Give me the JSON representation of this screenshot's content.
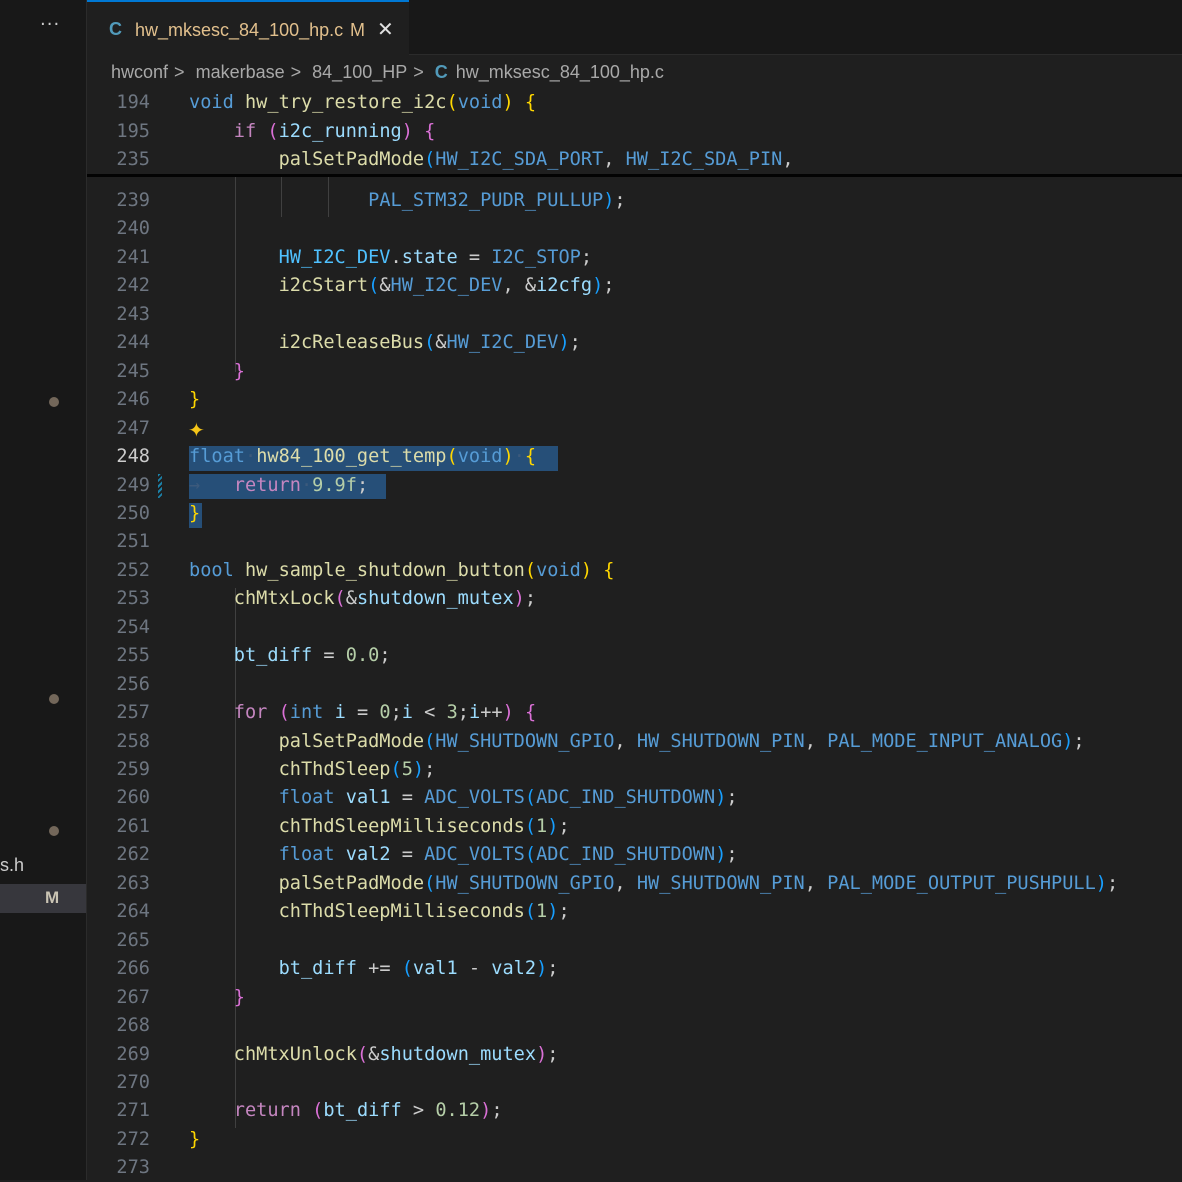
{
  "sidebar": {
    "more_label": "···",
    "file_fragment": "s.h",
    "file_status": "M"
  },
  "tab": {
    "icon": "C",
    "label": "hw_mksesc_84_100_hp.c",
    "modified": "M",
    "close": "✕"
  },
  "breadcrumb": {
    "items": [
      "hwconf",
      "makerbase",
      "84_100_HP"
    ],
    "file_icon": "C",
    "file": "hw_mksesc_84_100_hp.c",
    "separator": ">"
  },
  "sticky_lines": [
    {
      "ln": "194",
      "segments": [
        [
          "kw",
          "void"
        ],
        [
          "",
          " "
        ],
        [
          "fn",
          "hw_try_restore_i2c"
        ],
        [
          "p1",
          "("
        ],
        [
          "kw",
          "void"
        ],
        [
          "p1",
          ")"
        ],
        [
          "",
          ""
        ],
        [
          "",
          " "
        ],
        [
          "p1",
          "{"
        ]
      ]
    },
    {
      "ln": "195",
      "segments": [
        [
          "",
          "    "
        ],
        [
          "ctl",
          "if"
        ],
        [
          "",
          " "
        ],
        [
          "p2",
          "("
        ],
        [
          "var",
          "i2c_running"
        ],
        [
          "p2",
          ")"
        ],
        [
          "",
          " "
        ],
        [
          "p2",
          "{"
        ]
      ]
    },
    {
      "ln": "235",
      "segments": [
        [
          "",
          "        "
        ],
        [
          "fn",
          "palSetPadMode"
        ],
        [
          "p3",
          "("
        ],
        [
          "mac",
          "HW_I2C_SDA_PORT"
        ],
        [
          "",
          ", "
        ],
        [
          "mac",
          "HW_I2C_SDA_PIN"
        ],
        [
          "",
          ","
        ]
      ]
    }
  ],
  "code_lines": [
    {
      "ln": "239",
      "segments": [
        [
          "",
          "                "
        ],
        [
          "mac",
          "PAL_STM32_PUDR_PULLUP"
        ],
        [
          "p3",
          ")"
        ],
        [
          "",
          ";"
        ]
      ]
    },
    {
      "ln": "240",
      "segments": []
    },
    {
      "ln": "241",
      "segments": [
        [
          "",
          "        "
        ],
        [
          "cst",
          "HW_I2C_DEV"
        ],
        [
          "",
          ""
        ],
        [
          "",
          "."
        ],
        [
          "var",
          "state"
        ],
        [
          "",
          " = "
        ],
        [
          "mac",
          "I2C_STOP"
        ],
        [
          "",
          ";"
        ]
      ]
    },
    {
      "ln": "242",
      "segments": [
        [
          "",
          "        "
        ],
        [
          "fn",
          "i2cStart"
        ],
        [
          "p3",
          "("
        ],
        [
          "",
          "&"
        ],
        [
          "mac",
          "HW_I2C_DEV"
        ],
        [
          "",
          ", &"
        ],
        [
          "var",
          "i2cfg"
        ],
        [
          "p3",
          ")"
        ],
        [
          "",
          ";"
        ]
      ]
    },
    {
      "ln": "243",
      "segments": []
    },
    {
      "ln": "244",
      "segments": [
        [
          "",
          "        "
        ],
        [
          "fn",
          "i2cReleaseBus"
        ],
        [
          "p3",
          "("
        ],
        [
          "",
          "&"
        ],
        [
          "mac",
          "HW_I2C_DEV"
        ],
        [
          "p3",
          ")"
        ],
        [
          "",
          ";"
        ]
      ]
    },
    {
      "ln": "245",
      "segments": [
        [
          "",
          "    "
        ],
        [
          "p2",
          "}"
        ]
      ]
    },
    {
      "ln": "246",
      "segments": [
        [
          "p1",
          "}"
        ]
      ]
    },
    {
      "ln": "247",
      "segments": []
    },
    {
      "ln": "248",
      "segments": [
        [
          "kw",
          "float"
        ],
        [
          "ws",
          "·"
        ],
        [
          "fn",
          "hw84_100_get_temp"
        ],
        [
          "p1",
          "("
        ],
        [
          "kw",
          "void"
        ],
        [
          "p1",
          ")"
        ],
        [
          "ws",
          "·"
        ],
        [
          "p1",
          "{"
        ]
      ]
    },
    {
      "ln": "249",
      "segments": [
        [
          "ws",
          "→   "
        ],
        [
          "ctl",
          "return"
        ],
        [
          "ws",
          "·"
        ],
        [
          "num",
          "9.9f"
        ],
        [
          "",
          ";"
        ]
      ]
    },
    {
      "ln": "250",
      "segments": [
        [
          "p1",
          "}"
        ]
      ]
    },
    {
      "ln": "251",
      "segments": []
    },
    {
      "ln": "252",
      "segments": [
        [
          "kw",
          "bool"
        ],
        [
          "",
          " "
        ],
        [
          "fn",
          "hw_sample_shutdown_button"
        ],
        [
          "p1",
          "("
        ],
        [
          "kw",
          "void"
        ],
        [
          "p1",
          ")"
        ],
        [
          "",
          " "
        ],
        [
          "p1",
          "{"
        ]
      ]
    },
    {
      "ln": "253",
      "segments": [
        [
          "",
          "    "
        ],
        [
          "fn",
          "chMtxLock"
        ],
        [
          "p2",
          "("
        ],
        [
          "",
          "&"
        ],
        [
          "var",
          "shutdown_mutex"
        ],
        [
          "p2",
          ")"
        ],
        [
          "",
          ";"
        ]
      ]
    },
    {
      "ln": "254",
      "segments": []
    },
    {
      "ln": "255",
      "segments": [
        [
          "",
          "    "
        ],
        [
          "var",
          "bt_diff"
        ],
        [
          "",
          " = "
        ],
        [
          "num",
          "0.0"
        ],
        [
          "",
          ";"
        ]
      ]
    },
    {
      "ln": "256",
      "segments": []
    },
    {
      "ln": "257",
      "segments": [
        [
          "",
          "    "
        ],
        [
          "ctl",
          "for"
        ],
        [
          "",
          " "
        ],
        [
          "p2",
          "("
        ],
        [
          "kw",
          "int"
        ],
        [
          "",
          " "
        ],
        [
          "var",
          "i"
        ],
        [
          "",
          " = "
        ],
        [
          "num",
          "0"
        ],
        [
          "",
          ";"
        ],
        [
          "var",
          "i"
        ],
        [
          "",
          " < "
        ],
        [
          "num",
          "3"
        ],
        [
          "",
          ";"
        ],
        [
          "var",
          "i"
        ],
        [
          "",
          "++"
        ],
        [
          "p2",
          ")"
        ],
        [
          "",
          " "
        ],
        [
          "p2",
          "{"
        ]
      ]
    },
    {
      "ln": "258",
      "segments": [
        [
          "",
          "        "
        ],
        [
          "fn",
          "palSetPadMode"
        ],
        [
          "p3",
          "("
        ],
        [
          "mac",
          "HW_SHUTDOWN_GPIO"
        ],
        [
          "",
          ", "
        ],
        [
          "mac",
          "HW_SHUTDOWN_PIN"
        ],
        [
          "",
          ", "
        ],
        [
          "mac",
          "PAL_MODE_INPUT_ANALOG"
        ],
        [
          "p3",
          ")"
        ],
        [
          "",
          ";"
        ]
      ]
    },
    {
      "ln": "259",
      "segments": [
        [
          "",
          "        "
        ],
        [
          "fn",
          "chThdSleep"
        ],
        [
          "p3",
          "("
        ],
        [
          "num",
          "5"
        ],
        [
          "p3",
          ")"
        ],
        [
          "",
          ";"
        ]
      ]
    },
    {
      "ln": "260",
      "segments": [
        [
          "",
          "        "
        ],
        [
          "kw",
          "float"
        ],
        [
          "",
          " "
        ],
        [
          "var",
          "val1"
        ],
        [
          "",
          " = "
        ],
        [
          "mac",
          "ADC_VOLTS"
        ],
        [
          "p3",
          "("
        ],
        [
          "mac",
          "ADC_IND_SHUTDOWN"
        ],
        [
          "p3",
          ")"
        ],
        [
          "",
          ";"
        ]
      ]
    },
    {
      "ln": "261",
      "segments": [
        [
          "",
          "        "
        ],
        [
          "fn",
          "chThdSleepMilliseconds"
        ],
        [
          "p3",
          "("
        ],
        [
          "num",
          "1"
        ],
        [
          "p3",
          ")"
        ],
        [
          "",
          ";"
        ]
      ]
    },
    {
      "ln": "262",
      "segments": [
        [
          "",
          "        "
        ],
        [
          "kw",
          "float"
        ],
        [
          "",
          " "
        ],
        [
          "var",
          "val2"
        ],
        [
          "",
          " = "
        ],
        [
          "mac",
          "ADC_VOLTS"
        ],
        [
          "p3",
          "("
        ],
        [
          "mac",
          "ADC_IND_SHUTDOWN"
        ],
        [
          "p3",
          ")"
        ],
        [
          "",
          ";"
        ]
      ]
    },
    {
      "ln": "263",
      "segments": [
        [
          "",
          "        "
        ],
        [
          "fn",
          "palSetPadMode"
        ],
        [
          "p3",
          "("
        ],
        [
          "mac",
          "HW_SHUTDOWN_GPIO"
        ],
        [
          "",
          ", "
        ],
        [
          "mac",
          "HW_SHUTDOWN_PIN"
        ],
        [
          "",
          ", "
        ],
        [
          "mac",
          "PAL_MODE_OUTPUT_PUSHPULL"
        ],
        [
          "p3",
          ")"
        ],
        [
          "",
          ";"
        ]
      ]
    },
    {
      "ln": "264",
      "segments": [
        [
          "",
          "        "
        ],
        [
          "fn",
          "chThdSleepMilliseconds"
        ],
        [
          "p3",
          "("
        ],
        [
          "num",
          "1"
        ],
        [
          "p3",
          ")"
        ],
        [
          "",
          ";"
        ]
      ]
    },
    {
      "ln": "265",
      "segments": []
    },
    {
      "ln": "266",
      "segments": [
        [
          "",
          "        "
        ],
        [
          "var",
          "bt_diff"
        ],
        [
          "",
          " += "
        ],
        [
          "p3",
          "("
        ],
        [
          "var",
          "val1"
        ],
        [
          "",
          " - "
        ],
        [
          "var",
          "val2"
        ],
        [
          "p3",
          ")"
        ],
        [
          "",
          ";"
        ]
      ]
    },
    {
      "ln": "267",
      "segments": [
        [
          "",
          "    "
        ],
        [
          "p2",
          "}"
        ]
      ]
    },
    {
      "ln": "268",
      "segments": []
    },
    {
      "ln": "269",
      "segments": [
        [
          "",
          "    "
        ],
        [
          "fn",
          "chMtxUnlock"
        ],
        [
          "p2",
          "("
        ],
        [
          "",
          "&"
        ],
        [
          "var",
          "shutdown_mutex"
        ],
        [
          "p2",
          ")"
        ],
        [
          "",
          ";"
        ]
      ]
    },
    {
      "ln": "270",
      "segments": []
    },
    {
      "ln": "271",
      "segments": [
        [
          "",
          "    "
        ],
        [
          "ctl",
          "return"
        ],
        [
          "",
          " "
        ],
        [
          "p2",
          "("
        ],
        [
          "var",
          "bt_diff"
        ],
        [
          "",
          " > "
        ],
        [
          "num",
          "0.12"
        ],
        [
          "p2",
          ")"
        ],
        [
          "",
          ";"
        ]
      ]
    },
    {
      "ln": "272",
      "segments": [
        [
          "p1",
          "}"
        ]
      ]
    },
    {
      "ln": "273",
      "segments": []
    }
  ],
  "active_line": "248",
  "colors": {
    "background": "#1f1f1f",
    "selection": "#264f78",
    "accent": "#0078d4",
    "modified": "#e2c08d"
  }
}
